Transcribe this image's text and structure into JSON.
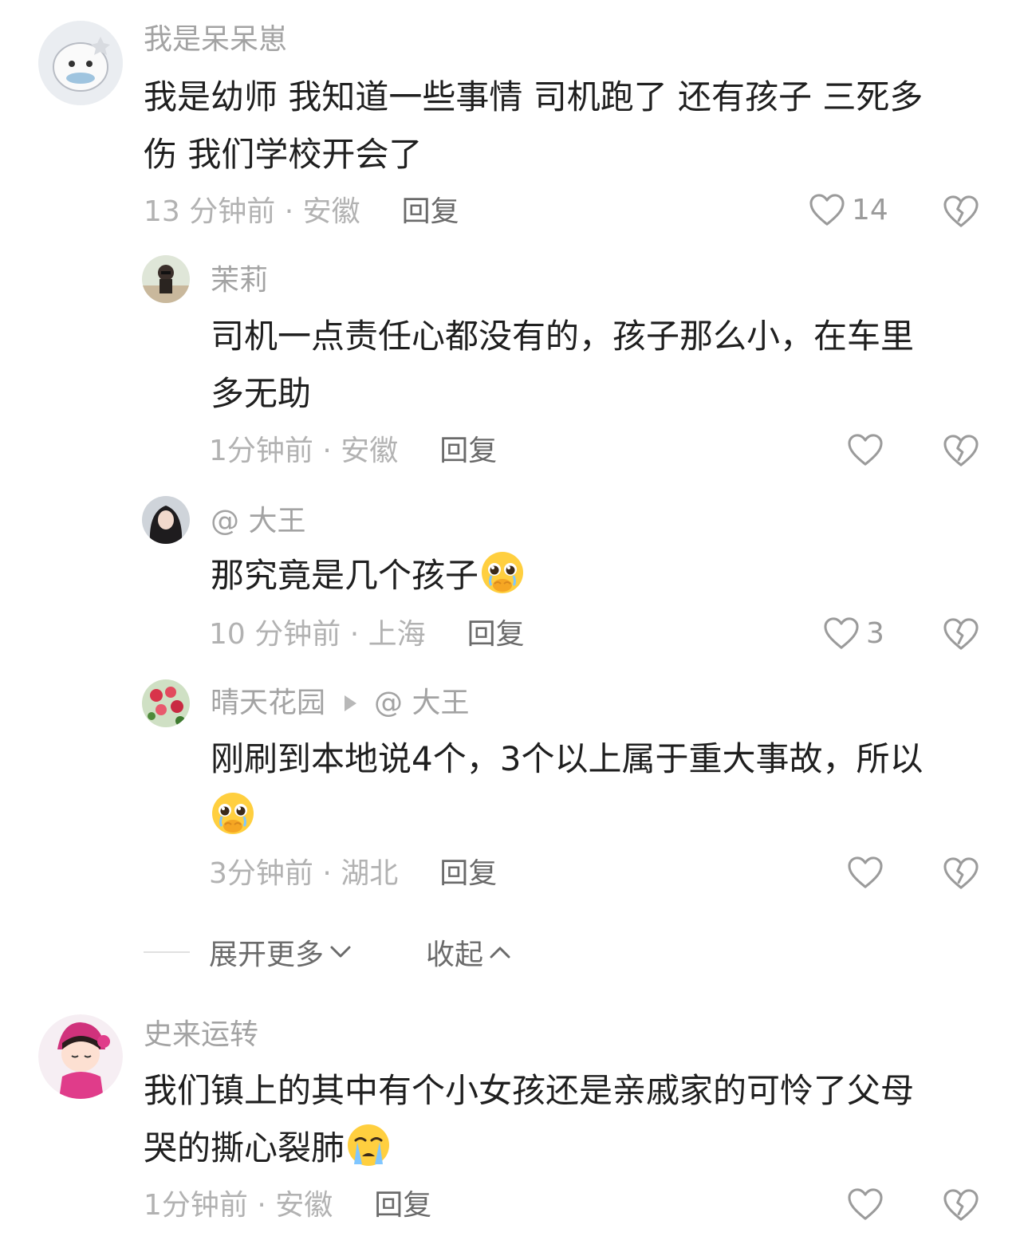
{
  "comments": [
    {
      "username": "我是呆呆崽",
      "line1": "我是幼师 我知道一些事情 司机跑了 还有孩子 三死多",
      "line2": "伤 我们学校开会了",
      "meta": "13 分钟前 · 安徽",
      "reply": "回复",
      "likes": "14",
      "avatar_icon": "cartoon-cat-avatar"
    },
    {
      "username": "茉莉",
      "line1": "司机一点责任心都没有的，孩子那么小，在车里",
      "line2": "多无助",
      "meta": "1分钟前 · 安徽",
      "reply": "回复",
      "likes": "",
      "avatar_icon": "person-photo-avatar"
    },
    {
      "username": "@  大王",
      "line1": "那究竟是几个孩子",
      "meta": "10 分钟前 · 上海",
      "reply": "回复",
      "likes": "3",
      "emoji": "pleading-face-emoji",
      "avatar_icon": "girl-photo-avatar"
    },
    {
      "username": "晴天花园",
      "reply_to": "@  大王",
      "line1": "刚刷到本地说4个，3个以上属于重大事故，所以",
      "meta": "3分钟前 · 湖北",
      "reply": "回复",
      "likes": "",
      "emoji": "pleading-face-emoji",
      "avatar_icon": "flowers-photo-avatar"
    },
    {
      "username": "史来运转",
      "line1": "我们镇上的其中有个小女孩还是亲戚家的可怜了父母",
      "line2": "哭的撕心裂肺",
      "meta": "1分钟前 · 安徽",
      "reply": "回复",
      "likes": "",
      "emoji": "loudly-crying-emoji",
      "avatar_icon": "cartoon-girl-avatar"
    }
  ],
  "thread_controls": {
    "expand_more": "展开更多",
    "collapse": "收起"
  },
  "colors": {
    "username": "#a3a3a3",
    "body": "#1f1f1f",
    "meta": "#b2b2b2",
    "reply": "#6a6a6a",
    "icon": "#9b9b9b"
  }
}
